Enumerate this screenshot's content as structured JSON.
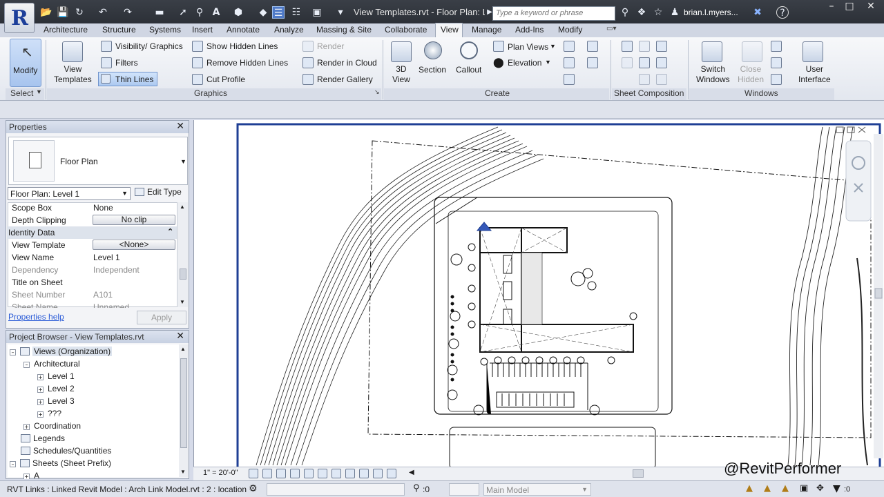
{
  "window": {
    "title": "View Templates.rvt - Floor Plan: L...",
    "search_placeholder": "Type a keyword or phrase",
    "user": "brian.l.myers...",
    "app_letter": "R"
  },
  "tabs": [
    "Architecture",
    "Structure",
    "Systems",
    "Insert",
    "Annotate",
    "Analyze",
    "Massing & Site",
    "Collaborate",
    "View",
    "Manage",
    "Add-Ins",
    "Modify"
  ],
  "ribbon": {
    "select": {
      "modify": "Modify",
      "select_label": "Select"
    },
    "graphics": {
      "view_templates": "View\nTemplates",
      "visibility_graphics": "Visibility/ Graphics",
      "filters": "Filters",
      "thin_lines": "Thin Lines",
      "show_hidden_lines": "Show  Hidden Lines",
      "remove_hidden_lines": "Remove  Hidden Lines",
      "cut_profile": "Cut  Profile",
      "render": "Render",
      "render_in_cloud": "Render  in Cloud",
      "render_gallery": "Render  Gallery",
      "panel_title": "Graphics"
    },
    "create": {
      "view_3d": "3D\nView",
      "section": "Section",
      "callout": "Callout",
      "plan_views": "Plan  Views",
      "elevation": "Elevation",
      "panel_title": "Create"
    },
    "sheet_composition": {
      "panel_title": "Sheet Composition"
    },
    "windows": {
      "switch_windows": "Switch\nWindows",
      "close_hidden": "Close\nHidden",
      "user_interface": "User\nInterface",
      "panel_title": "Windows"
    }
  },
  "properties": {
    "title": "Properties",
    "type_name": "Floor Plan",
    "selector": "Floor Plan: Level 1",
    "edit_type": "Edit Type",
    "rows": [
      {
        "key": "Scope Box",
        "value": "None"
      },
      {
        "key": "Depth Clipping",
        "value": "No clip"
      },
      {
        "key": "Identity Data",
        "value": ""
      },
      {
        "key": "View Template",
        "value": "<None>"
      },
      {
        "key": "View Name",
        "value": "Level 1"
      },
      {
        "key": "Dependency",
        "value": "Independent"
      },
      {
        "key": "Title on Sheet",
        "value": ""
      },
      {
        "key": "Sheet Number",
        "value": "A101"
      },
      {
        "key": "Sheet Name",
        "value": "Unnamed"
      }
    ],
    "help": "Properties help",
    "apply": "Apply"
  },
  "browser": {
    "title": "Project Browser - View Templates.rvt",
    "items": [
      "Views (Organization)",
      "Architectural",
      "Level 1",
      "Level 2",
      "Level 3",
      "???",
      "Coordination",
      "Legends",
      "Schedules/Quantities",
      "Sheets (Sheet Prefix)",
      "A"
    ]
  },
  "view_control": {
    "scale": "1\" = 20'-0\""
  },
  "status": {
    "text": "RVT Links : Linked Revit Model : Arch Link Model.rvt : 2 : location",
    "worksets": ":0",
    "model": "Main Model",
    "filter_count": ":0"
  },
  "watermark": "@RevitPerformer"
}
